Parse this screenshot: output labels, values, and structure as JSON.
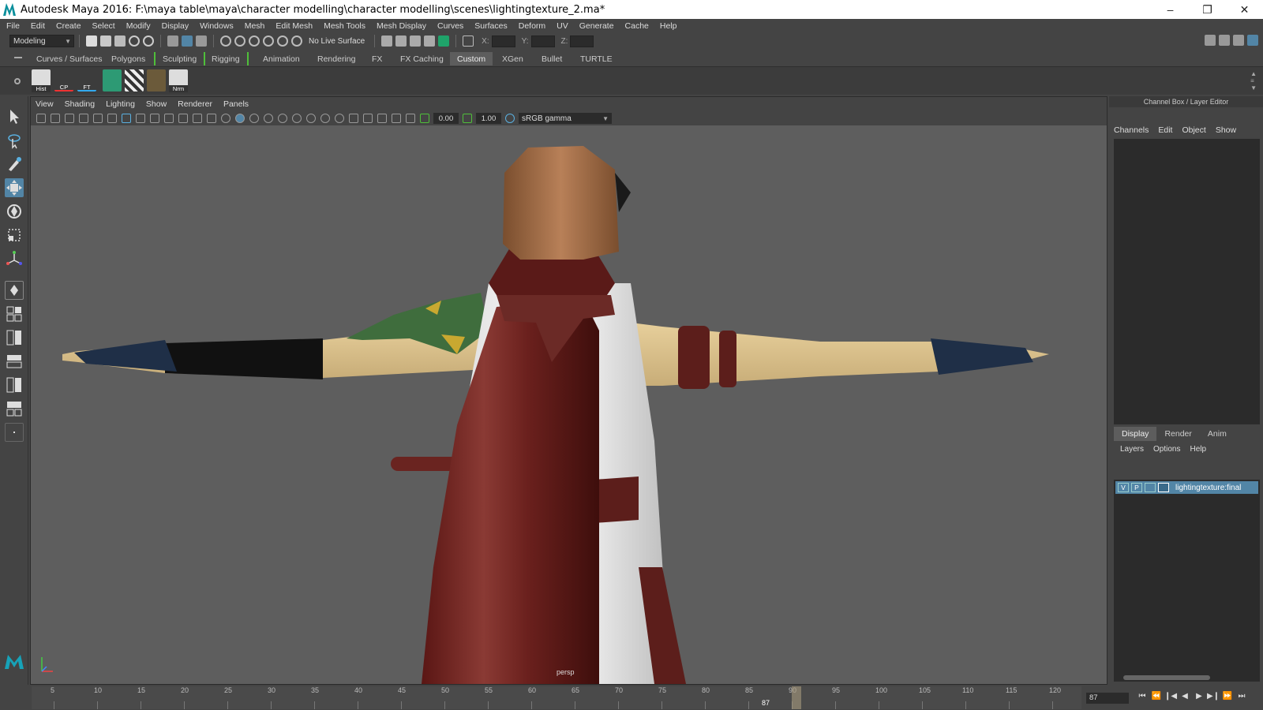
{
  "window": {
    "title": "Autodesk Maya 2016: F:\\maya table\\maya\\character modelling\\character modelling\\scenes\\lightingtexture_2.ma*",
    "minimize": "–",
    "maximize": "❐",
    "close": "✕"
  },
  "menubar": [
    "File",
    "Edit",
    "Create",
    "Select",
    "Modify",
    "Display",
    "Windows",
    "Mesh",
    "Edit Mesh",
    "Mesh Tools",
    "Mesh Display",
    "Curves",
    "Surfaces",
    "Deform",
    "UV",
    "Generate",
    "Cache",
    "Help"
  ],
  "statusline": {
    "mode": "Modeling",
    "live_surface": "No Live Surface",
    "x_label": "X:",
    "y_label": "Y:",
    "z_label": "Z:"
  },
  "shelf": {
    "tabs": [
      "Curves / Surfaces",
      "Polygons",
      "Sculpting",
      "Rigging",
      "Animation",
      "Rendering",
      "FX",
      "FX Caching",
      "Custom",
      "XGen",
      "Bullet",
      "TURTLE"
    ],
    "active_tab": "Custom",
    "icons": [
      "Hist",
      "CP",
      "FT",
      "",
      "",
      "",
      "Nrm"
    ]
  },
  "viewport": {
    "menus": [
      "View",
      "Shading",
      "Lighting",
      "Show",
      "Renderer",
      "Panels"
    ],
    "exposure": "0.00",
    "gamma": "1.00",
    "color_space": "sRGB gamma",
    "camera_label": "persp"
  },
  "channel_box": {
    "title": "Channel Box / Layer Editor",
    "menus": [
      "Channels",
      "Edit",
      "Object",
      "Show"
    ]
  },
  "layer_editor": {
    "tabs": [
      "Display",
      "Render",
      "Anim"
    ],
    "active_tab": "Display",
    "menus": [
      "Layers",
      "Options",
      "Help"
    ],
    "layers": [
      {
        "v": "V",
        "p": "P",
        "name": "lightingtexture:final"
      }
    ]
  },
  "timeline": {
    "ticks": [
      "5",
      "10",
      "15",
      "20",
      "25",
      "30",
      "35",
      "40",
      "45",
      "50",
      "55",
      "60",
      "65",
      "70",
      "75",
      "80",
      "85",
      "90",
      "95",
      "100",
      "105",
      "110",
      "115",
      "120"
    ],
    "current_frame": "87",
    "current_frame_field": "87"
  }
}
